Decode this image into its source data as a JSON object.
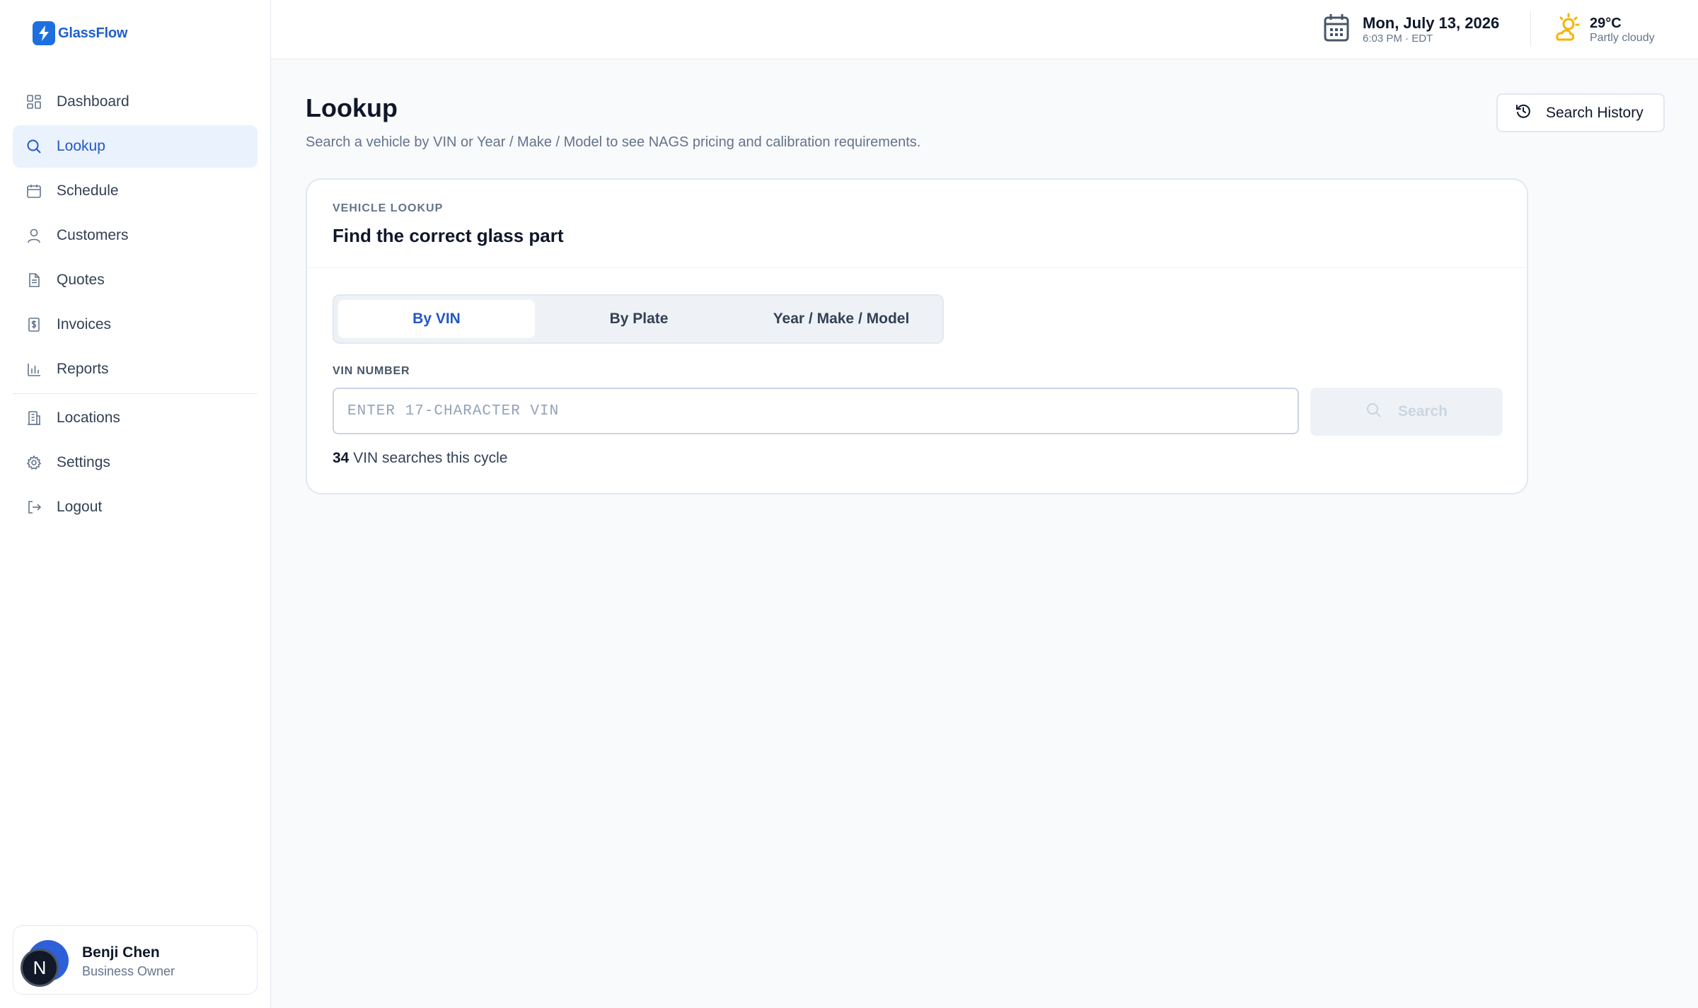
{
  "app": {
    "name": "GlassFlow",
    "accent": "#1d6fe0"
  },
  "sidebar": {
    "items": [
      {
        "label": "Dashboard",
        "icon": "dashboard-icon"
      },
      {
        "label": "Lookup",
        "icon": "search-icon",
        "active": true
      },
      {
        "label": "Schedule",
        "icon": "calendar-icon"
      },
      {
        "label": "Customers",
        "icon": "user-icon"
      },
      {
        "label": "Quotes",
        "icon": "document-icon"
      },
      {
        "label": "Invoices",
        "icon": "invoice-icon"
      },
      {
        "label": "Reports",
        "icon": "bar-chart-icon"
      }
    ],
    "secondary": [
      {
        "label": "Locations",
        "icon": "building-icon"
      },
      {
        "label": "Settings",
        "icon": "gear-icon"
      },
      {
        "label": "Logout",
        "icon": "logout-icon"
      }
    ],
    "user": {
      "initial": "N",
      "name": "Benji Chen",
      "role": "Business Owner"
    }
  },
  "header": {
    "date": "Mon, July 13, 2026",
    "time": "6:03 PM · EDT",
    "temperature": "29°C",
    "condition": "Partly cloudy"
  },
  "main": {
    "title": "Lookup",
    "subtitle": "Search a vehicle by VIN or Year / Make / Model to see NAGS pricing and calibration requirements.",
    "history_label": "Search History",
    "card": {
      "kicker": "VEHICLE LOOKUP",
      "title": "Find the correct glass part",
      "tabs": [
        {
          "label": "By VIN",
          "active": true
        },
        {
          "label": "By Plate"
        },
        {
          "label": "Year / Make / Model"
        }
      ],
      "field_label": "VIN NUMBER",
      "vin_placeholder": "ENTER 17-CHARACTER VIN",
      "vin_value": "",
      "search_label": "Search",
      "search_count": "34",
      "search_count_suffix": "VIN searches this cycle"
    }
  }
}
